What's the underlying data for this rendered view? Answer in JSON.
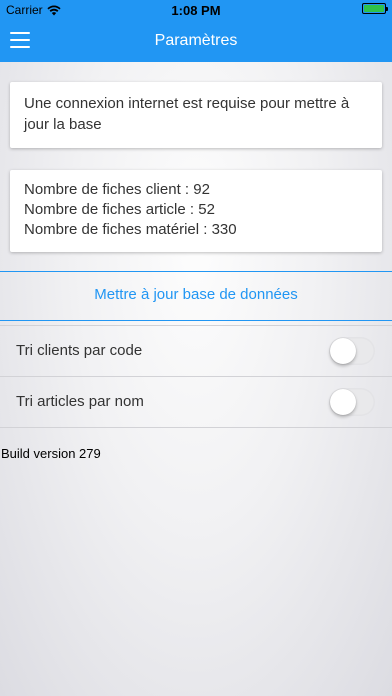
{
  "status_bar": {
    "carrier": "Carrier",
    "time": "1:08 PM",
    "battery_level": 1.0,
    "battery_color": "#2ec24a",
    "wifi_icon": "wifi-icon"
  },
  "nav": {
    "title": "Paramètres",
    "menu_icon": "hamburger-menu-icon",
    "color": "#2196f3"
  },
  "notice": {
    "text": "Une connexion internet est requise pour mettre à jour la base"
  },
  "counts": {
    "clients": "Nombre de fiches client : 92",
    "articles": "Nombre de fiches article : 52",
    "materiel": "Nombre de fiches matériel : 330"
  },
  "update_button": {
    "label": "Mettre à jour base de données"
  },
  "settings": [
    {
      "label": "Tri clients par code",
      "on": false
    },
    {
      "label": "Tri articles par nom",
      "on": false
    }
  ],
  "build": {
    "text": "Build version 279"
  }
}
